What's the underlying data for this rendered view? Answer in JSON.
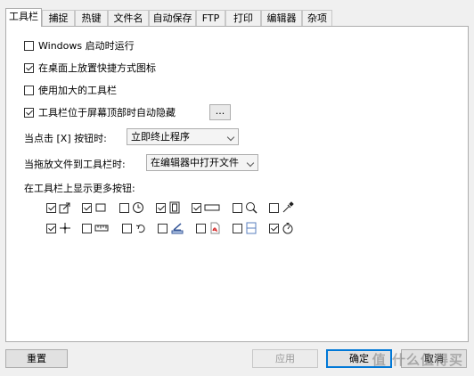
{
  "tabs": [
    {
      "label": "工具栏",
      "active": true
    },
    {
      "label": "捕捉"
    },
    {
      "label": "热键"
    },
    {
      "label": "文件名"
    },
    {
      "label": "自动保存"
    },
    {
      "label": "FTP"
    },
    {
      "label": "打印"
    },
    {
      "label": "编辑器"
    },
    {
      "label": "杂项"
    }
  ],
  "options": [
    {
      "label": "Windows 启动时运行",
      "checked": false
    },
    {
      "label": "在桌面上放置快捷方式图标",
      "checked": true
    },
    {
      "label": "使用加大的工具栏",
      "checked": false
    },
    {
      "label": "工具栏位于屏幕顶部时自动隐藏",
      "checked": true
    }
  ],
  "ellipsis_label": "...",
  "close_action": {
    "label": "当点击 [X] 按钮时:",
    "value": "立即终止程序"
  },
  "drop_action": {
    "label": "当拖放文件到工具栏时:",
    "value": "在编辑器中打开文件"
  },
  "more_buttons_label": "在工具栏上显示更多按钮:",
  "toolbar_buttons": [
    {
      "icon": "share-arrow-icon",
      "checked": true
    },
    {
      "icon": "rectangle-crop-icon",
      "checked": true
    },
    {
      "icon": "clock-icon",
      "checked": false
    },
    {
      "icon": "film-strip-icon",
      "checked": true
    },
    {
      "icon": "minus-box-icon",
      "checked": true
    },
    {
      "icon": "magnifier-icon",
      "checked": false
    },
    {
      "icon": "eyedropper-icon",
      "checked": false
    },
    {
      "icon": "crosshair-icon",
      "checked": true
    },
    {
      "icon": "ruler-icon",
      "checked": false
    },
    {
      "icon": "rotate-icon",
      "checked": false
    },
    {
      "icon": "scanner-icon",
      "checked": false
    },
    {
      "icon": "pdf-icon",
      "checked": false
    },
    {
      "icon": "split-window-icon",
      "checked": false
    },
    {
      "icon": "stopwatch-icon",
      "checked": true
    }
  ],
  "buttons": {
    "reset": "重置",
    "apply": "应用",
    "ok": "确定",
    "cancel": "取消"
  },
  "watermark": "值 什么值得买"
}
